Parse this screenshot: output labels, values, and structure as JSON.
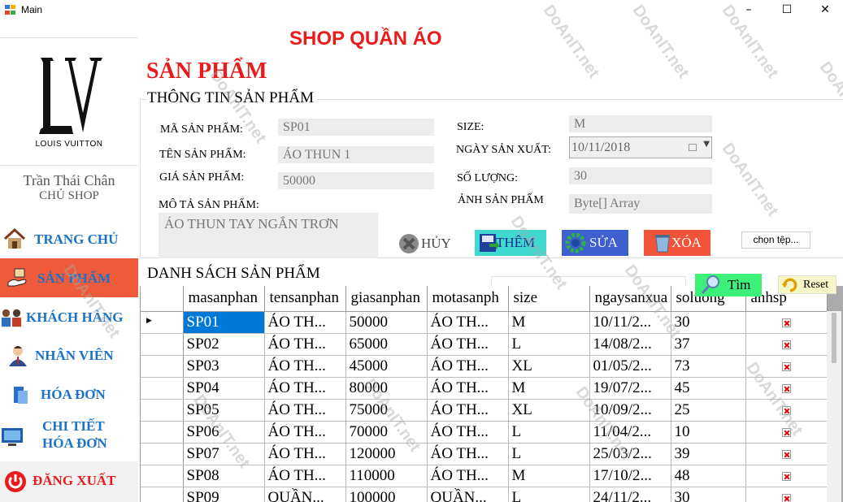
{
  "window": {
    "title": "Main",
    "minimize": "–",
    "maximize": "☐",
    "close": "✕"
  },
  "sidebar": {
    "logo_caption": "LOUIS VUITTON",
    "user_name": "Trần Thái Chân",
    "user_role": "CHỦ SHOP",
    "items": [
      {
        "label": "TRANG CHỦ",
        "icon": "house-icon"
      },
      {
        "label": "SẢN PHẨM",
        "icon": "hand-box-icon",
        "active": true
      },
      {
        "label": "KHÁCH HÀNG",
        "icon": "people-icon"
      },
      {
        "label": "NHÂN VIÊN",
        "icon": "person-icon"
      },
      {
        "label": "HÓA ĐƠN",
        "icon": "receipt-icon"
      },
      {
        "label": "CHI TIẾT",
        "label2": "HÓA ĐƠN",
        "icon": "monitor-icon"
      },
      {
        "label": "ĐĂNG XUẤT",
        "icon": "power-icon"
      }
    ]
  },
  "header": {
    "shop_title": "SHOP QUẦN ÁO",
    "section_title": "SẢN PHẨM"
  },
  "form": {
    "group_title": "THÔNG TIN SẢN PHẨM",
    "ma_label": "MÃ SẢN PHẨM:",
    "ma_value": "SP01",
    "ten_label": "TÊN SẢN PHẨM:",
    "ten_value": "ÁO THUN 1",
    "gia_label": "GIÁ SẢN PHẨM:",
    "gia_value": "50000",
    "mota_label": "MÔ TẢ SẢN PHẨM:",
    "mota_value": "ÁO THUN TAY NGẮN TRƠN",
    "size_label": "SIZE:",
    "size_value": "M",
    "ngay_label": "NGÀY SẢN XUẤT:",
    "ngay_value": "10/11/2018",
    "soluong_label": "SỐ LƯỢNG:",
    "soluong_value": "30",
    "anh_label": "ẢNH SẢN PHẨM",
    "anh_value": "Byte[] Array"
  },
  "buttons": {
    "huy": "HỦY",
    "them": "THÊM",
    "sua": "SỬA",
    "xoa": "XÓA",
    "chon_tep": "chọn tệp...",
    "tim": "Tìm",
    "reset": "Reset"
  },
  "colors": {
    "accent_red": "#e81c1c",
    "nav_blue": "#1a73c8",
    "active_bg": "#ee5a3a",
    "them_bg": "#3fd9cf",
    "sua_bg": "#3d5fd0",
    "xoa_bg": "#f2543a",
    "tim_bg": "#3cf07a"
  },
  "list": {
    "title": "DANH SÁCH SẢN PHẨM",
    "columns": [
      "masanphan",
      "tensanphan",
      "giasanphan",
      "motasanph",
      "size",
      "ngaysanxua",
      "soluong",
      "anhsp"
    ],
    "rows": [
      [
        "SP01",
        "ÁO TH...",
        "50000",
        "ÁO TH...",
        "M",
        "10/11/2...",
        "30"
      ],
      [
        "SP02",
        "ÁO TH...",
        "65000",
        "ÁO TH...",
        "L",
        "14/08/2...",
        "37"
      ],
      [
        "SP03",
        "ÁO TH...",
        "45000",
        "ÁO TH...",
        "XL",
        "01/05/2...",
        "73"
      ],
      [
        "SP04",
        "ÁO TH...",
        "80000",
        "ÁO TH...",
        "M",
        "19/07/2...",
        "45"
      ],
      [
        "SP05",
        "ÁO TH...",
        "75000",
        "ÁO TH...",
        "XL",
        "10/09/2...",
        "25"
      ],
      [
        "SP06",
        "ÁO TH...",
        "70000",
        "ÁO TH...",
        "L",
        "11/04/2...",
        "10"
      ],
      [
        "SP07",
        "ÁO TH...",
        "120000",
        "ÁO TH...",
        "L",
        "25/03/2...",
        "39"
      ],
      [
        "SP08",
        "ÁO TH...",
        "110000",
        "ÁO TH...",
        "M",
        "17/10/2...",
        "48"
      ],
      [
        "SP09",
        "QUẦN...",
        "100000",
        "QUẦN...",
        "L",
        "24/11/2...",
        "30"
      ]
    ]
  },
  "watermark": "DoAnIT.net"
}
